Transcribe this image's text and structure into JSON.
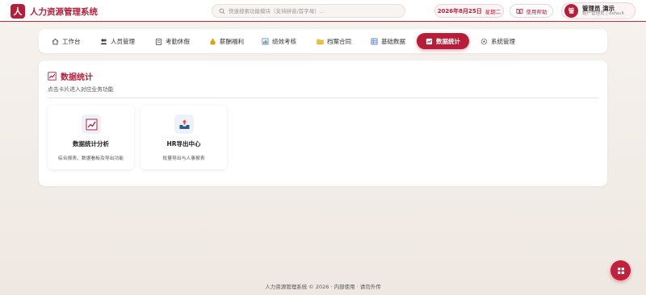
{
  "app": {
    "logo_char": "人",
    "title": "人力资源管理系统"
  },
  "search": {
    "placeholder": "快速搜索功能模块（支持拼音/首字母）..."
  },
  "date": {
    "date_text": "2026年8月25日",
    "weekday": "星期二"
  },
  "help": {
    "label": "使用帮助"
  },
  "user": {
    "avatar_char": "管",
    "name": "管理员 演示",
    "role": "租户管理员 | default"
  },
  "nav": {
    "items": [
      {
        "label": "工作台",
        "icon": "home-icon"
      },
      {
        "label": "人员管理",
        "icon": "people-icon"
      },
      {
        "label": "考勤休假",
        "icon": "clipboard-icon"
      },
      {
        "label": "薪酬福利",
        "icon": "money-bag-icon"
      },
      {
        "label": "绩效考核",
        "icon": "bar-chart-icon"
      },
      {
        "label": "档案合同",
        "icon": "folder-icon"
      },
      {
        "label": "基础数据",
        "icon": "table-icon"
      },
      {
        "label": "数据统计",
        "icon": "chart-icon",
        "active": true
      },
      {
        "label": "系统管理",
        "icon": "gear-icon"
      }
    ]
  },
  "panel": {
    "title": "数据统计",
    "subtitle": "点击卡片进入对应业务功能",
    "cards": [
      {
        "title": "数据统计分析",
        "desc": "综合报表、数据看板及导出功能",
        "icon": "chart-line-icon"
      },
      {
        "title": "HR导出中心",
        "desc": "批量导出与人事报表",
        "icon": "outbox-icon"
      }
    ]
  },
  "footer": {
    "text": "人力资源管理系统 © 2026 · 内部使用 · 请勿外传"
  },
  "colors": {
    "accent": "#b71c38",
    "background": "#f3eee9"
  }
}
